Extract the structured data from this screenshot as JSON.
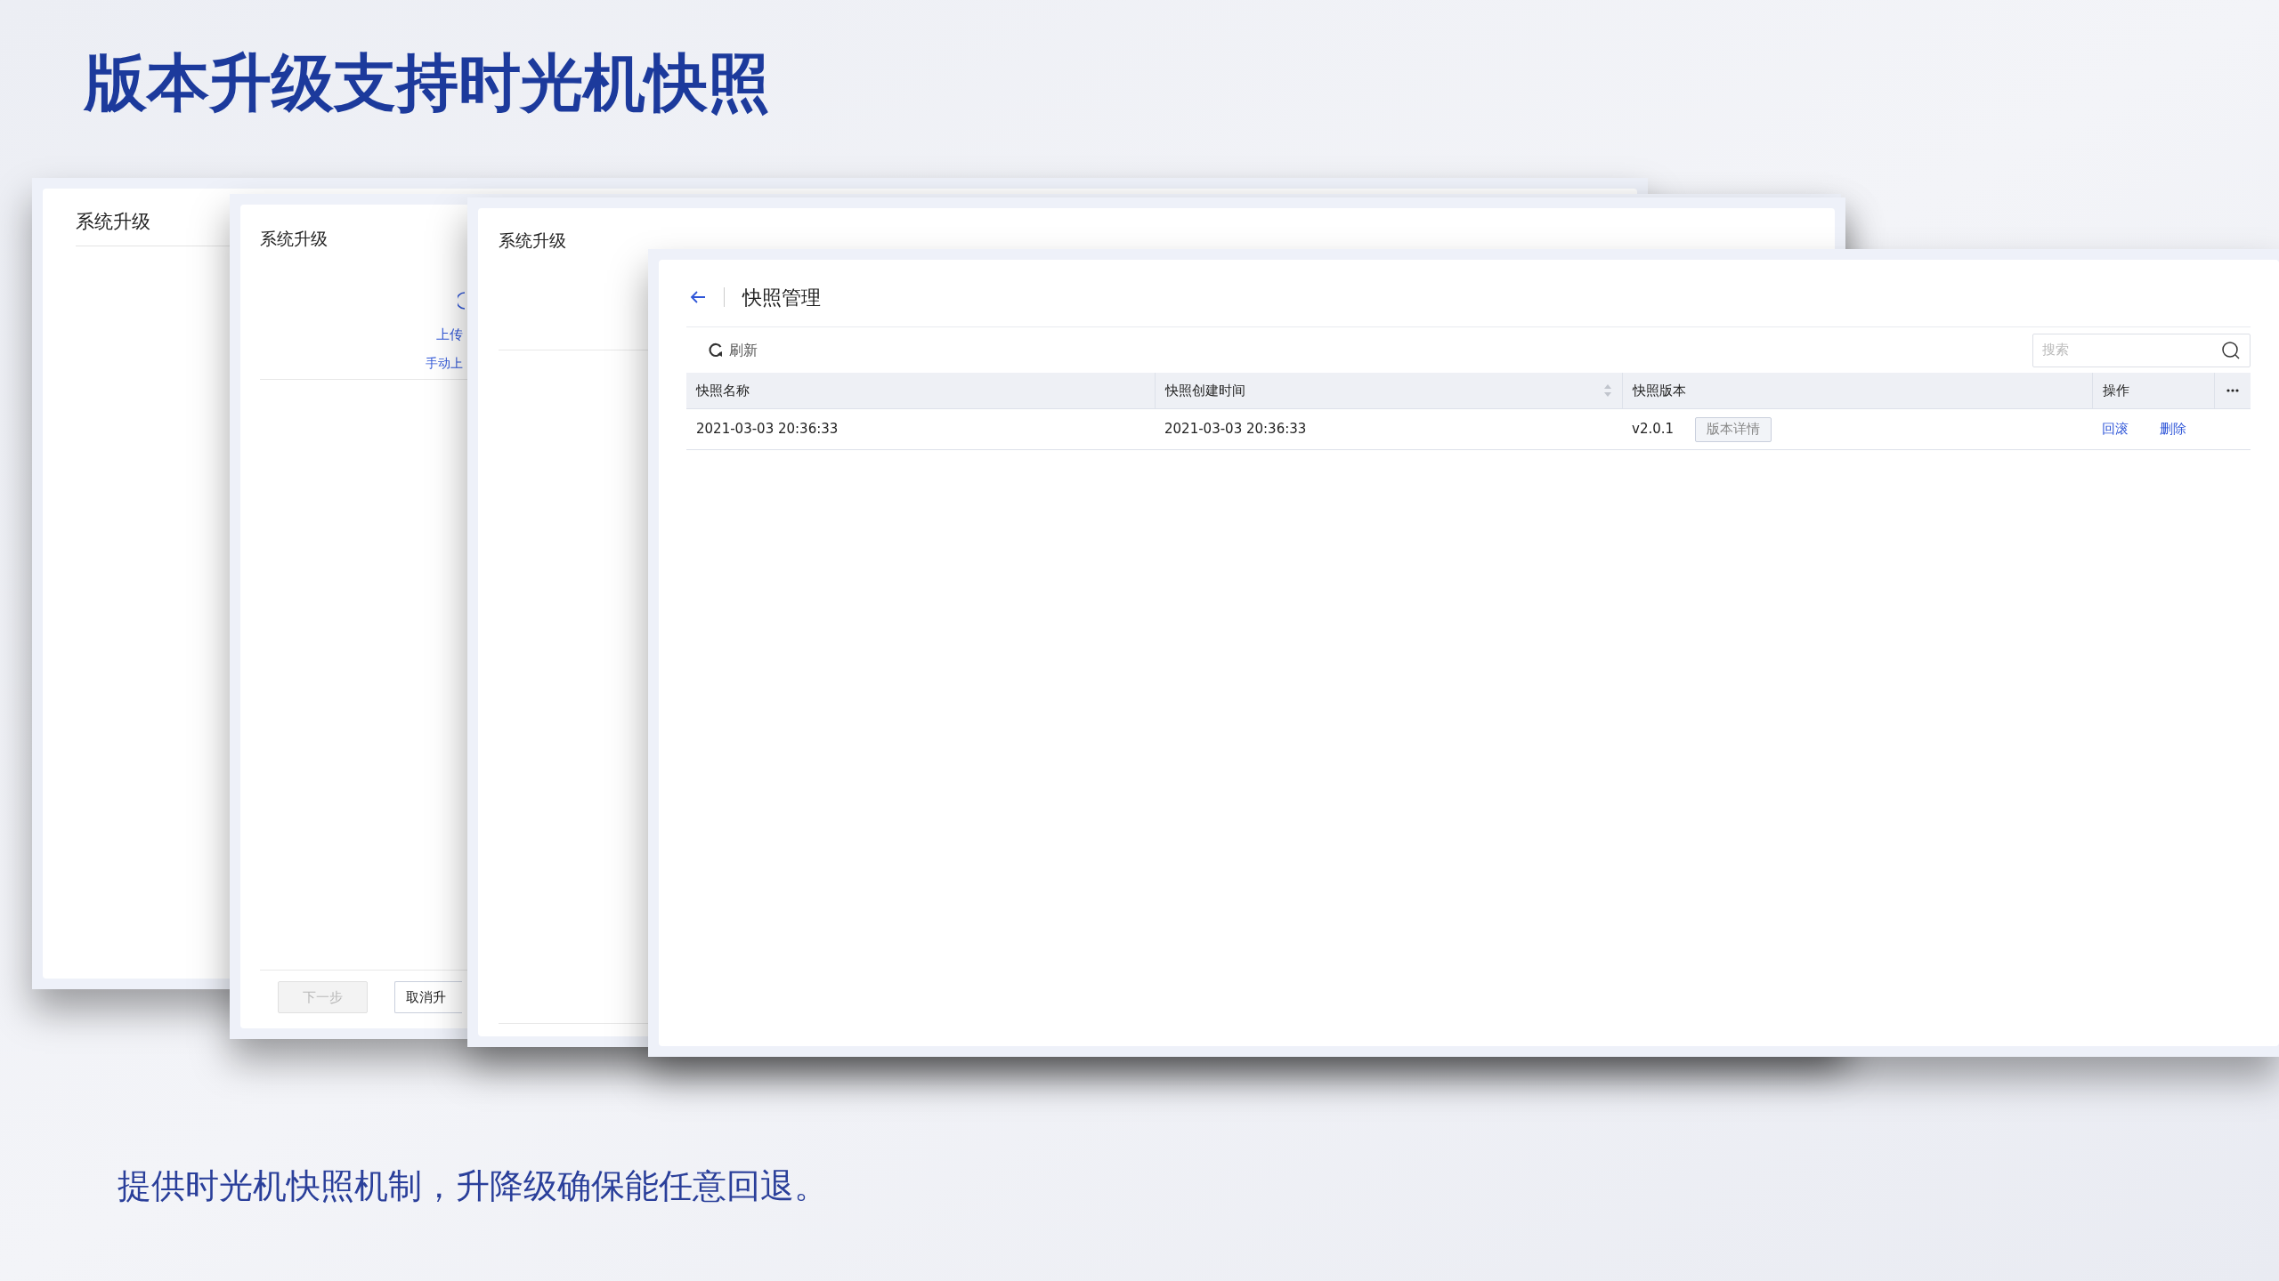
{
  "headline": "版本升级支持时光机快照",
  "windows": [
    {
      "title": "系统升级"
    },
    {
      "title": "系统升级",
      "links": [
        "上传",
        "手动上"
      ],
      "buttons": [
        {
          "label": "下一步",
          "disabled": true
        },
        {
          "label": "取消升",
          "disabled": false
        }
      ]
    },
    {
      "title": "系统升级"
    }
  ],
  "snapshot_window": {
    "title": "快照管理",
    "toolbar": {
      "refresh": "刷新",
      "search": {
        "placeholder": "搜索"
      }
    },
    "table": {
      "columns": [
        {
          "label": "快照名称",
          "sortable": false
        },
        {
          "label": "快照创建时间",
          "sortable": true
        },
        {
          "label": "快照版本",
          "sortable": false
        },
        {
          "label": "操作",
          "sortable": false
        }
      ],
      "rows": [
        {
          "name": "2021-03-03 20:36:33",
          "created": "2021-03-03 20:36:33",
          "version": "v2.0.1",
          "details": "版本详情",
          "actions": [
            "回滚",
            "删除"
          ]
        }
      ]
    }
  },
  "caption": "提供时光机快照机制，升降级确保能任意回退。"
}
